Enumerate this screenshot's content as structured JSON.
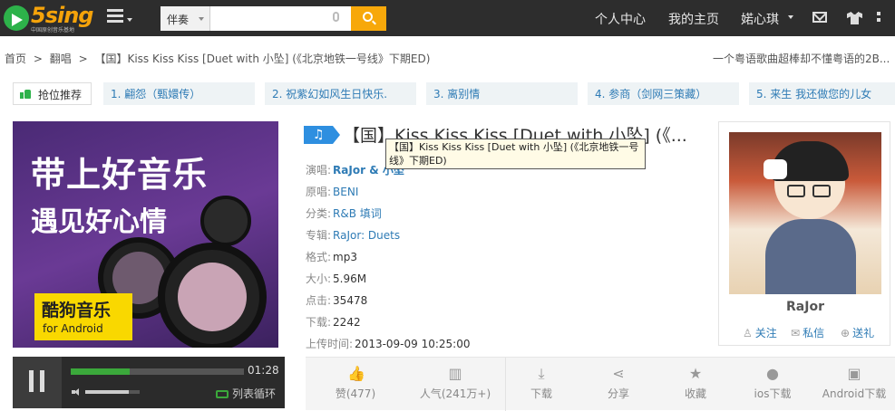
{
  "header": {
    "logo": "5sing",
    "logo_sub": "中国原创音乐基地",
    "search_type": "伴奏",
    "search_placeholder": "",
    "nav": [
      "个人中心",
      "我的主页",
      "婼心琪"
    ]
  },
  "breadcrumb": {
    "home": "首页",
    "sep": ">",
    "section": "翻唱",
    "current": "【国】Kiss Kiss Kiss [Duet with 小坠] (《北京地铁一号线》下期ED)"
  },
  "ticker": "一个粤语歌曲超棒却不懂粤语的2B...",
  "recommend": {
    "label": "抢位推荐",
    "items": [
      "1. 翩怨（甄嬛传）",
      "2. 祝紫幻如风生日快乐.",
      "3. 离别情",
      "4. 参商（剑网三策藏）",
      "5. 来生 我还做您的儿女"
    ]
  },
  "ad": {
    "line1": "带上好音乐",
    "line2": "遇见好心情",
    "badge_title": "酷狗音乐",
    "badge_sub": "for Android"
  },
  "player": {
    "time": "01:28",
    "progress": 0.34,
    "volume": 0.8,
    "loop_label": "列表循环"
  },
  "song": {
    "title": "【国】Kiss Kiss Kiss [Duet with 小坠] (《...",
    "tooltip": "【国】Kiss Kiss Kiss [Duet with 小坠] (《北京地铁一号线》下期ED)",
    "meta": [
      {
        "label": "演唱:",
        "value": "RaJor & 小坠",
        "style": "link bold"
      },
      {
        "label": "原唱:",
        "value": "BENI",
        "style": "link"
      },
      {
        "label": "分类:",
        "value": "R&B 填词",
        "style": "link"
      },
      {
        "label": "专辑:",
        "value": "RaJor: Duets",
        "style": "link"
      },
      {
        "label": "格式:",
        "value": "mp3",
        "style": "v"
      },
      {
        "label": "大小:",
        "value": "5.96M",
        "style": "v"
      },
      {
        "label": "点击:",
        "value": "35478",
        "style": "v"
      },
      {
        "label": "下载:",
        "value": "2242",
        "style": "v"
      },
      {
        "label": "上传时间:",
        "value": "2013-09-09 10:25:00",
        "style": "v"
      }
    ]
  },
  "actions": [
    {
      "icon": "thumbs-up-icon",
      "glyph": "👍",
      "label": "赞(477)"
    },
    {
      "icon": "bar-chart-icon",
      "glyph": "▥",
      "label": "人气(241万+)"
    },
    {
      "icon": "download-icon",
      "glyph": "⤓",
      "label": "下载"
    },
    {
      "icon": "share-icon",
      "glyph": "⋖",
      "label": "分享"
    },
    {
      "icon": "star-icon",
      "glyph": "★",
      "label": "收藏"
    },
    {
      "icon": "apple-icon",
      "glyph": "●",
      "label": "ios下载"
    },
    {
      "icon": "android-icon",
      "glyph": "▣",
      "label": "Android下载"
    }
  ],
  "artist": {
    "name": "RaJor",
    "follow": "关注",
    "message": "私信",
    "gift": "送礼"
  }
}
